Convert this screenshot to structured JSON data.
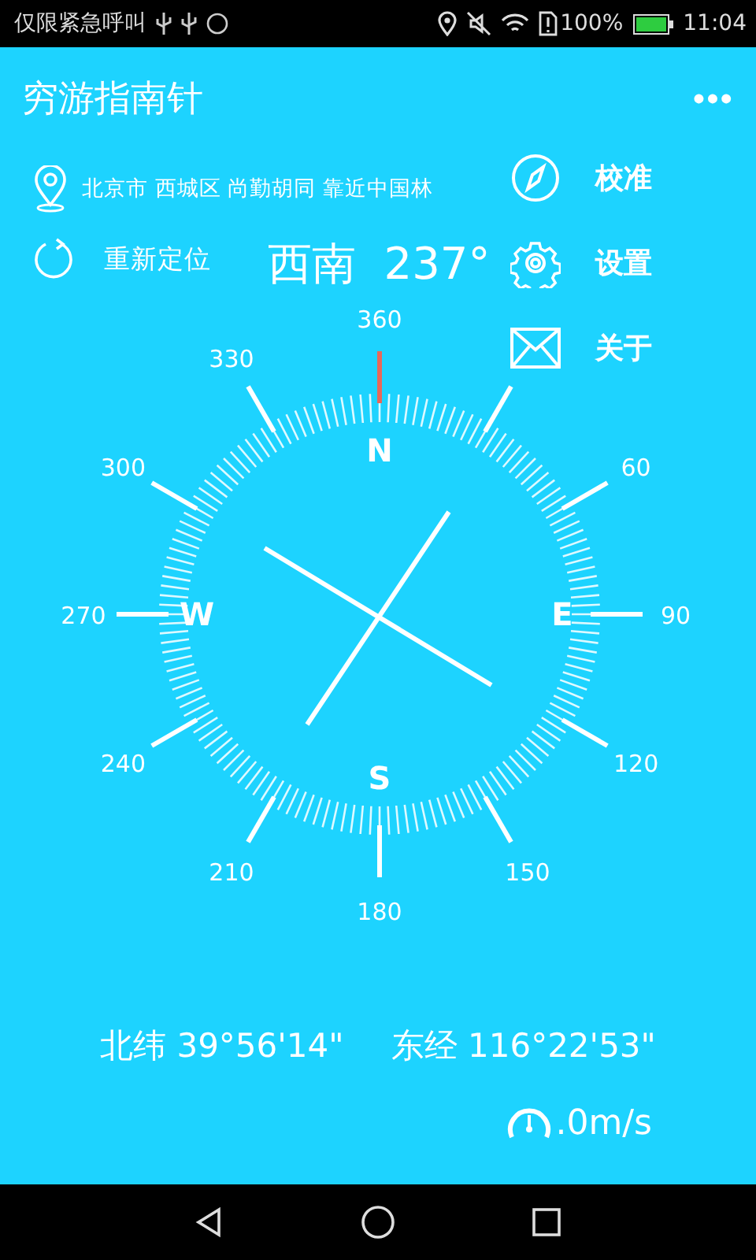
{
  "status_bar": {
    "carrier": "仅限紧急呼叫",
    "battery": "100%",
    "time": "11:04"
  },
  "app_bar": {
    "title": "穷游指南针",
    "menu": "•••"
  },
  "location": {
    "address": "北京市 西城区 尚勤胡同 靠近中国林",
    "relocate": "重新定位"
  },
  "heading": {
    "direction": "西南",
    "degrees": "237°"
  },
  "actions": [
    {
      "kind": "compass",
      "label": "校准"
    },
    {
      "kind": "gear",
      "label": "设置"
    },
    {
      "kind": "mail",
      "label": "关于"
    }
  ],
  "compass": {
    "degree_labels": [
      "360",
      "60",
      "90",
      "120",
      "150",
      "180",
      "210",
      "240",
      "270",
      "300",
      "330"
    ],
    "letters": [
      "N",
      "E",
      "S",
      "W"
    ]
  },
  "coordinates": {
    "latitude": "北纬 39°56'14\"",
    "longitude": "东经 116°22'53\""
  },
  "speed": {
    "value": ".0m/s"
  }
}
